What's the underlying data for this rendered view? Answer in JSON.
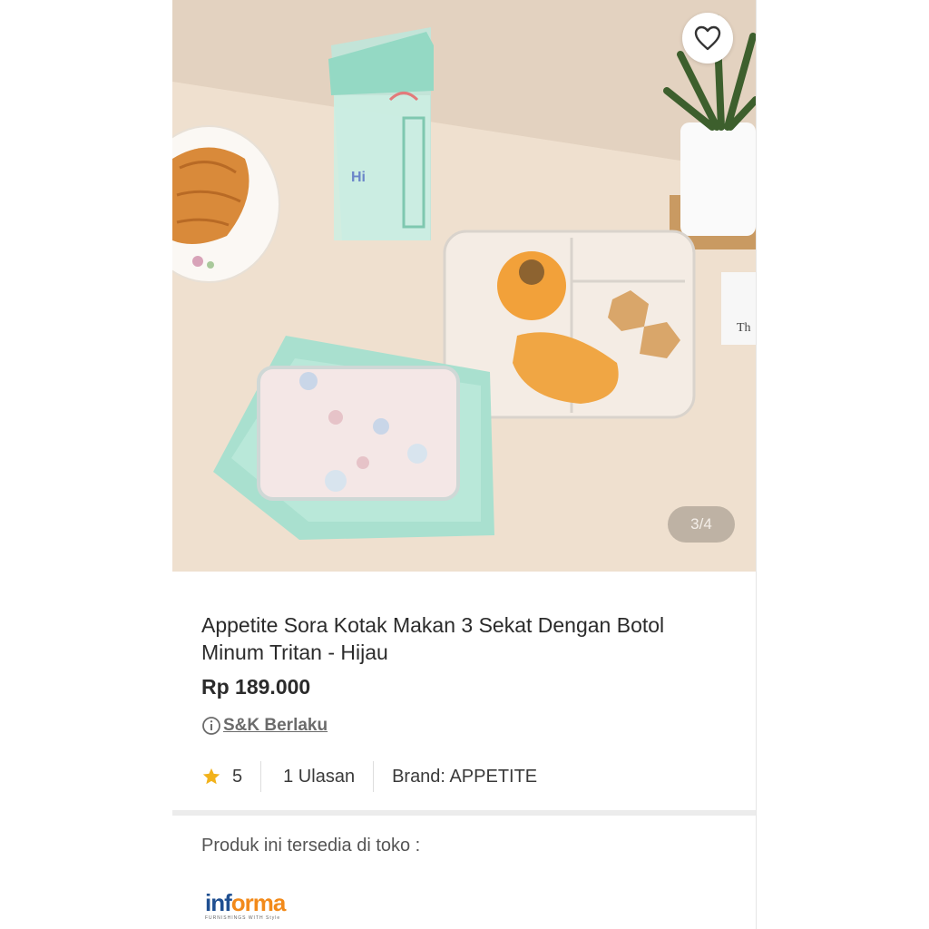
{
  "gallery": {
    "counter": "3/4",
    "image_alt": "Appetite Sora lunch box and water bottle on a table",
    "print_on_box": "Th"
  },
  "product": {
    "title": "Appetite Sora Kotak Makan 3 Sekat Dengan Botol Minum Tritan - Hijau",
    "price": "Rp 189.000",
    "terms_label": "S&K Berlaku",
    "rating": "5",
    "reviews": "1 Ulasan",
    "brand_label": "Brand:",
    "brand_value": "APPETITE"
  },
  "availability": {
    "heading": "Produk ini tersedia di toko :",
    "store_logo": "informa",
    "store_logo_part1": "inf",
    "store_logo_part2": "orma",
    "store_tagline": "FURNISHINGS WITH Style"
  },
  "colors": {
    "mint": "#a9e0cf",
    "rating_star": "#f2b21b",
    "brand_blue": "#1f4f91",
    "brand_orange": "#f28a1a"
  }
}
